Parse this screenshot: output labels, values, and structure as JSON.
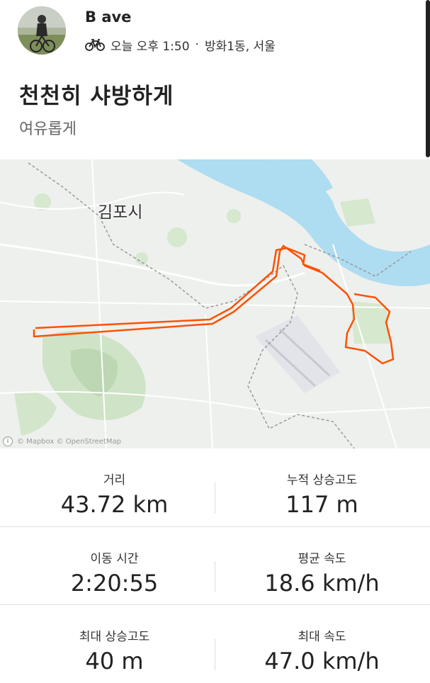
{
  "header": {
    "athlete_name": "B ave",
    "time": "오늘 오후 1:50",
    "separator": "·",
    "location": "방화1동, 서울",
    "activity_icon": "bicycle-icon"
  },
  "activity": {
    "title": "천천히 샤방하게",
    "description": "여유롭게"
  },
  "map": {
    "place_label": "김포시",
    "attribution": "© Mapbox © OpenStreetMap",
    "route_color": "#fc5200"
  },
  "stats": [
    {
      "label": "거리",
      "value": "43.72 km"
    },
    {
      "label": "누적 상승고도",
      "value": "117 m"
    },
    {
      "label": "이동 시간",
      "value": "2:20:55"
    },
    {
      "label": "평균 속도",
      "value": "18.6 km/h"
    },
    {
      "label": "최대 상승고도",
      "value": "40 m"
    },
    {
      "label": "최대 속도",
      "value": "47.0 km/h"
    }
  ]
}
